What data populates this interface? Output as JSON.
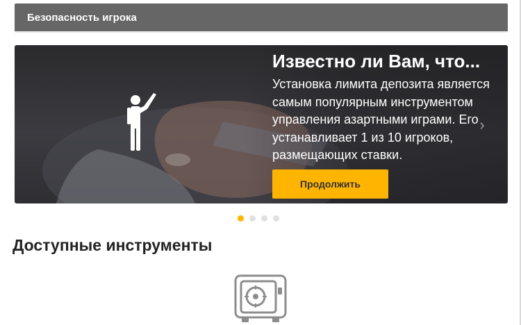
{
  "header": {
    "title": "Безопасность игрока"
  },
  "banner": {
    "title": "Известно ли Вам, что...",
    "text": "Установка лимита депозита является самым популярным инструментом управления азартными играми. Его устанавливает 1 из 10 игроков, размещающих ставки.",
    "button_label": "Продолжить",
    "icon": "person-raising-hand-icon",
    "next_icon": "chevron-right-icon"
  },
  "carousel": {
    "total_slides": 4,
    "active_slide": 1
  },
  "tools": {
    "title": "Доступные инструменты",
    "first_tool_icon": "safe-icon"
  },
  "colors": {
    "accent": "#ffb400",
    "header_bg": "#666666",
    "text_dark": "#222222"
  }
}
